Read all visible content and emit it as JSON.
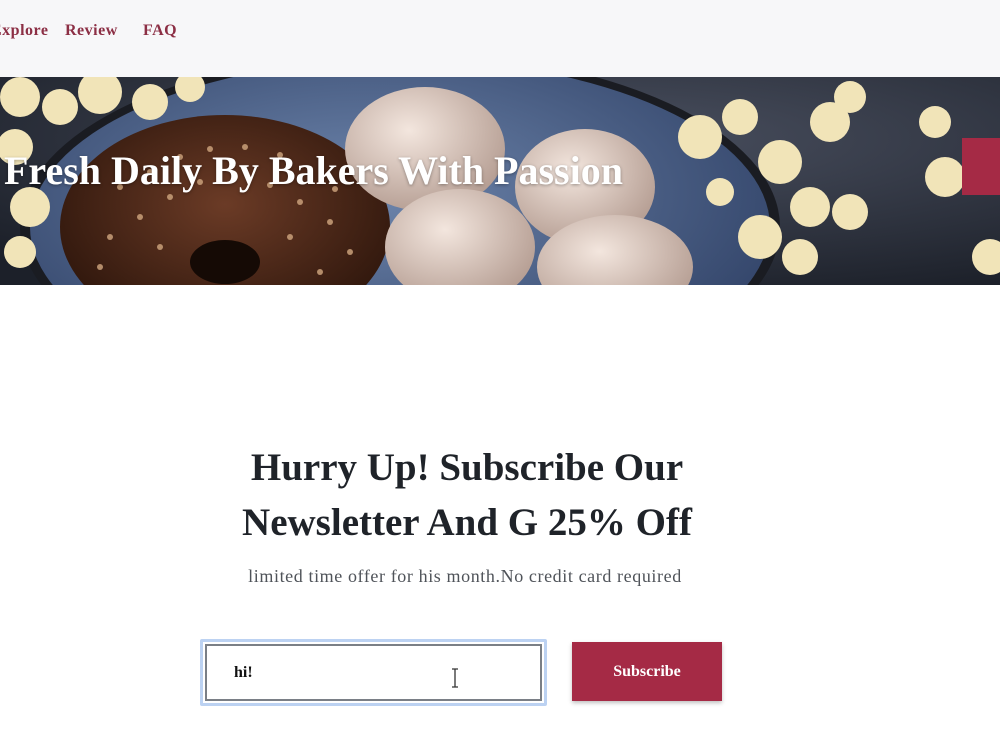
{
  "nav": {
    "items": [
      {
        "label": "Explore"
      },
      {
        "label": "Review"
      },
      {
        "label": "FAQ"
      }
    ]
  },
  "hero": {
    "title": "Fresh Daily By Bakers With Passion"
  },
  "newsletter": {
    "title_line1": "Hurry Up! Subscribe Our",
    "title_line2": "Newsletter And G 25% Off",
    "subtitle": "limited time offer for his month.No credit card required",
    "email_value": "hi!",
    "subscribe_label": "Subscribe"
  },
  "colors": {
    "accent": "#a52a45",
    "nav_text": "#8c2f45",
    "heading": "#1f2329",
    "nav_bg": "#f7f7f9",
    "input_focus_ring": "#bcd2f2"
  }
}
